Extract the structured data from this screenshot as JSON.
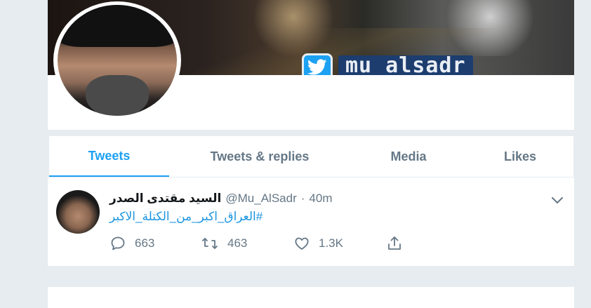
{
  "banner": {
    "handle_text": "mu_alsadr"
  },
  "nav": {
    "tabs": [
      {
        "label": "Tweets",
        "active": true
      },
      {
        "label": "Tweets & replies",
        "active": false
      },
      {
        "label": "Media",
        "active": false
      },
      {
        "label": "Likes",
        "active": false
      }
    ]
  },
  "tweet": {
    "display_name": "السيد مقتدى الصدر",
    "handle": "@Mu_AlSadr",
    "separator": "·",
    "time": "40m",
    "text": "#العراق_اكبر_من_الكتلة_الاكبر",
    "replies": "663",
    "retweets": "463",
    "likes": "1.3K"
  },
  "icons": {
    "reply": "reply-icon",
    "retweet": "retweet-icon",
    "like": "heart-icon",
    "share": "share-icon",
    "caret": "chevron-down-icon",
    "twitter_bird": "twitter-bird-icon"
  },
  "colors": {
    "accent": "#1da1f2",
    "link": "#1b95e0",
    "muted": "#657786",
    "background": "#e6ecf0"
  }
}
